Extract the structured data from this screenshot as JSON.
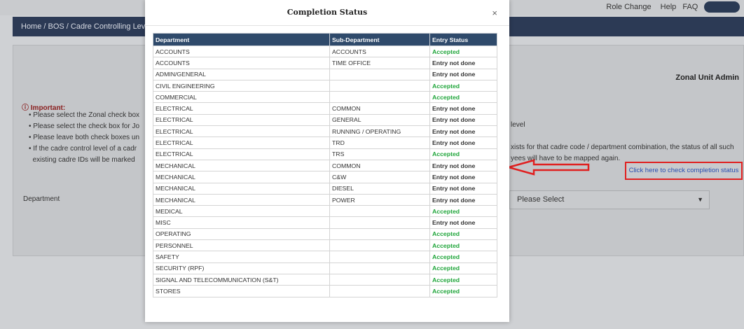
{
  "background": {
    "topbar_right": {
      "role_link": "Role Change",
      "help": "Help",
      "faq": "FAQ"
    },
    "breadcrumb": "Home / BOS / Cadre Controlling Levels",
    "user_role": "Zonal Unit Admin",
    "important_label": "Important:",
    "bullets": [
      "Please select the Zonal check box",
      "Please select the check box for Jo",
      "Please leave both check boxes un",
      "If the cadre control level of a cadr",
      "existing cadre IDs will be marked"
    ],
    "right_fragments": [
      "level",
      "xists for that cadre code / department combination, the status of all such",
      "yees will have to be mapped again."
    ],
    "check_link": "Click here to check completion status",
    "department_label": "Department",
    "select_value": "Please Select"
  },
  "modal": {
    "title": "Completion Status",
    "close_icon": "×",
    "columns": [
      "Department",
      "Sub-Department",
      "Entry Status"
    ],
    "rows": [
      {
        "dept": "ACCOUNTS",
        "sub": "ACCOUNTS",
        "status": "Accepted"
      },
      {
        "dept": "ACCOUNTS",
        "sub": "TIME OFFICE",
        "status": "Entry not done"
      },
      {
        "dept": "ADMIN/GENERAL",
        "sub": "",
        "status": "Entry not done"
      },
      {
        "dept": "CIVIL ENGINEERING",
        "sub": "",
        "status": "Accepted"
      },
      {
        "dept": "COMMERCIAL",
        "sub": "",
        "status": "Accepted"
      },
      {
        "dept": "ELECTRICAL",
        "sub": "COMMON",
        "status": "Entry not done"
      },
      {
        "dept": "ELECTRICAL",
        "sub": "GENERAL",
        "status": "Entry not done"
      },
      {
        "dept": "ELECTRICAL",
        "sub": "RUNNING / OPERATING",
        "status": "Entry not done"
      },
      {
        "dept": "ELECTRICAL",
        "sub": "TRD",
        "status": "Entry not done"
      },
      {
        "dept": "ELECTRICAL",
        "sub": "TRS",
        "status": "Accepted"
      },
      {
        "dept": "MECHANICAL",
        "sub": "COMMON",
        "status": "Entry not done"
      },
      {
        "dept": "MECHANICAL",
        "sub": "C&W",
        "status": "Entry not done"
      },
      {
        "dept": "MECHANICAL",
        "sub": "DIESEL",
        "status": "Entry not done"
      },
      {
        "dept": "MECHANICAL",
        "sub": "POWER",
        "status": "Entry not done"
      },
      {
        "dept": "MEDICAL",
        "sub": "",
        "status": "Accepted"
      },
      {
        "dept": "MISC",
        "sub": "",
        "status": "Entry not done"
      },
      {
        "dept": "OPERATING",
        "sub": "",
        "status": "Accepted"
      },
      {
        "dept": "PERSONNEL",
        "sub": "",
        "status": "Accepted"
      },
      {
        "dept": "SAFETY",
        "sub": "",
        "status": "Accepted"
      },
      {
        "dept": "SECURITY (RPF)",
        "sub": "",
        "status": "Accepted"
      },
      {
        "dept": "SIGNAL AND TELECOMMUNICATION (S&T)",
        "sub": "",
        "status": "Accepted"
      },
      {
        "dept": "STORES",
        "sub": "",
        "status": "Accepted"
      }
    ]
  },
  "colors": {
    "accepted": "#1fa53a",
    "header": "#2f4a6b",
    "highlight": "#e02020"
  }
}
